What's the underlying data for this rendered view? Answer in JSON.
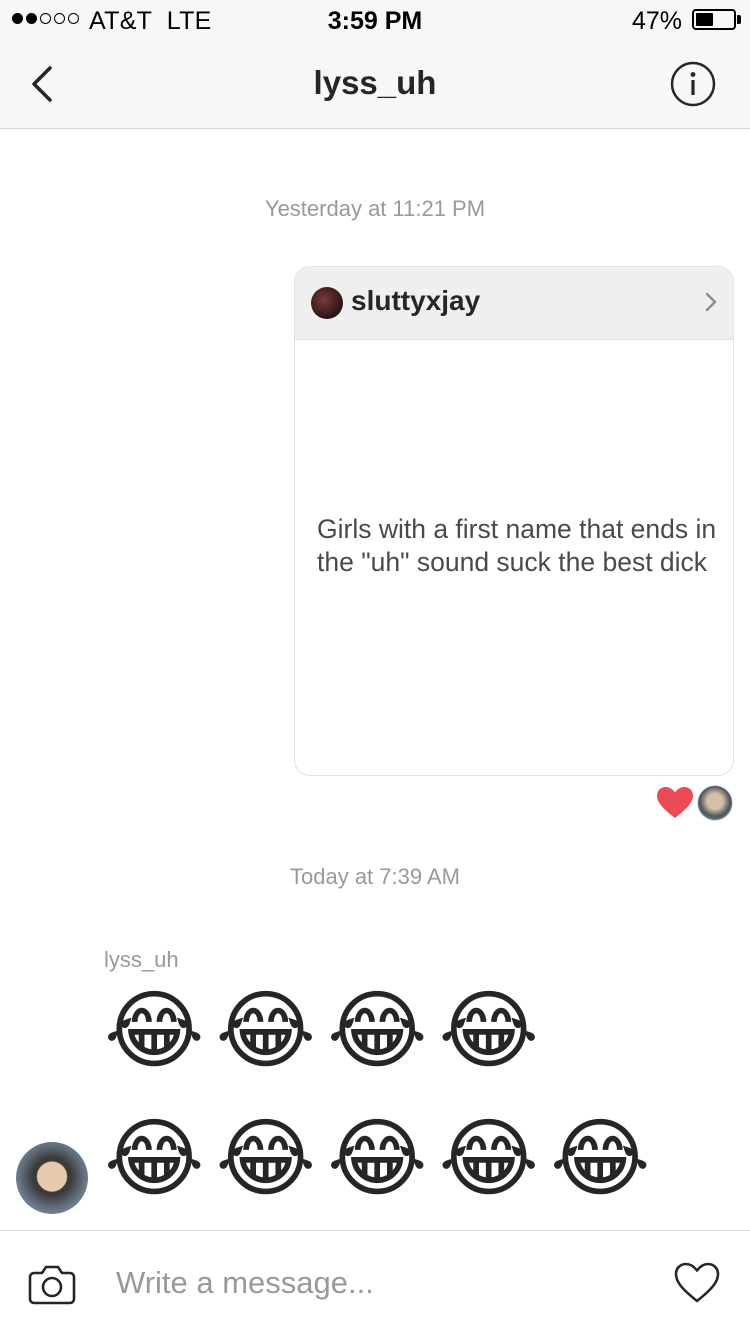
{
  "status_bar": {
    "carrier": "AT&T",
    "network": "LTE",
    "time": "3:59 PM",
    "battery_percent": "47%",
    "battery_level": 0.47,
    "signal_bars_filled": 2,
    "signal_bars_total": 5
  },
  "header": {
    "title": "lyss_uh",
    "back_icon": "chevron-left-icon",
    "info_icon": "info-circle-icon"
  },
  "thread": {
    "timestamp_1": "Yesterday at 11:21 PM",
    "shared_post": {
      "username": "sluttyxjay",
      "text": "Girls with a first name that ends in the \"uh\" sound suck the best dick"
    },
    "reaction": {
      "icon": "heart-icon",
      "color": "#ed4956"
    },
    "timestamp_2": "Today at 7:39 AM",
    "sender_name": "lyss_uh",
    "message_1": "😂😂😂😂",
    "message_2": "😂😂😂😂😂"
  },
  "composer": {
    "placeholder": "Write a message...",
    "camera_icon": "camera-icon",
    "like_icon": "heart-outline-icon"
  }
}
